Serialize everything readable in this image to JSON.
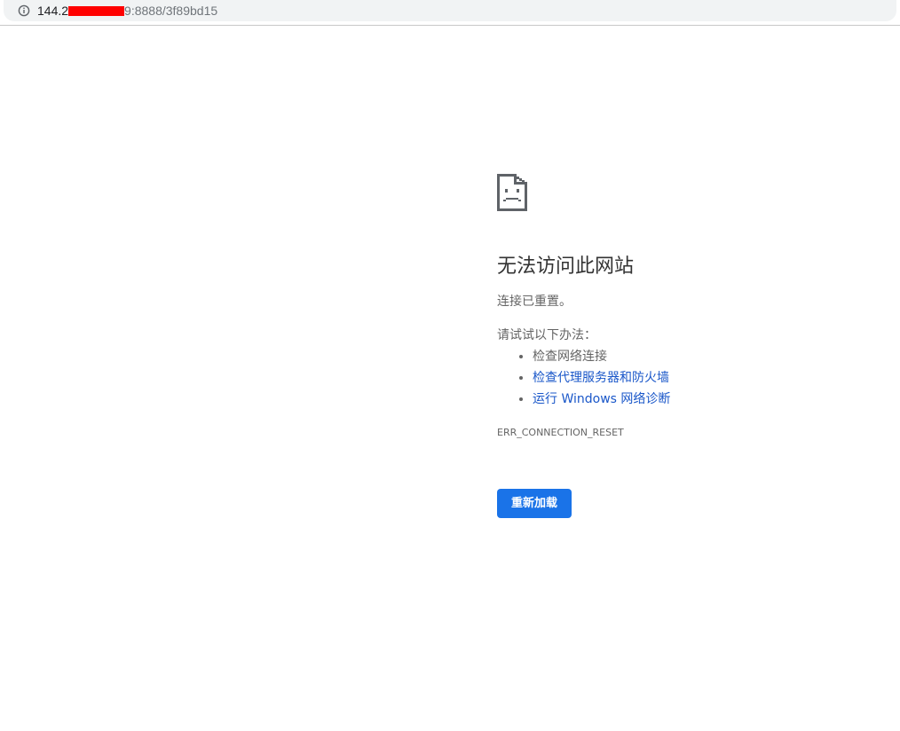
{
  "address_bar": {
    "url_host_visible": "144.2",
    "url_path": "9:8888/3f89bd15",
    "info_icon": "info-circle-icon"
  },
  "error": {
    "icon": "sad-document-icon",
    "title": "无法访问此网站",
    "subtitle": "连接已重置。",
    "suggestions_header": "请试试以下办法：",
    "suggestions": [
      {
        "label": "检查网络连接",
        "link": false
      },
      {
        "label": "检查代理服务器和防火墙",
        "link": true
      },
      {
        "label": "运行 Windows 网络诊断",
        "link": true
      }
    ],
    "error_code": "ERR_CONNECTION_RESET",
    "reload_label": "重新加载"
  },
  "colors": {
    "accent": "#1a73e8",
    "link": "#1a57c9",
    "text": "#646464",
    "title": "#333333",
    "redaction": "#ff0000"
  }
}
